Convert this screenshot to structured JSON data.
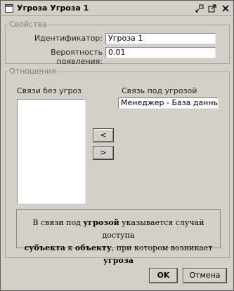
{
  "window": {
    "title": "Угроза Угроза 1"
  },
  "properties": {
    "legend": "Свойства",
    "id_label": "Идентификатор:",
    "id_value": "Угроза 1",
    "prob_label": "Вероятность появления:",
    "prob_value": "0.01"
  },
  "relations": {
    "legend": "Отношения",
    "left_header": "Связи без угроз",
    "right_header": "Связь под угрозой",
    "right_value": "Менеджер - База данных",
    "move_left": "<",
    "move_right": ">"
  },
  "info": {
    "p1": "В связи под ",
    "b1": "угрозой",
    "p2": " указывается случай доступа",
    "b2": "субъекта",
    "p3": " к ",
    "b3": "объекту",
    "p4": ", при котором возникает ",
    "b4": "угроза"
  },
  "buttons": {
    "ok": "OK",
    "cancel": "Отмена"
  },
  "icons": {
    "window": "window-icon",
    "minimize": "minimize-icon",
    "maximize": "maximize-icon",
    "close": "close-icon"
  }
}
